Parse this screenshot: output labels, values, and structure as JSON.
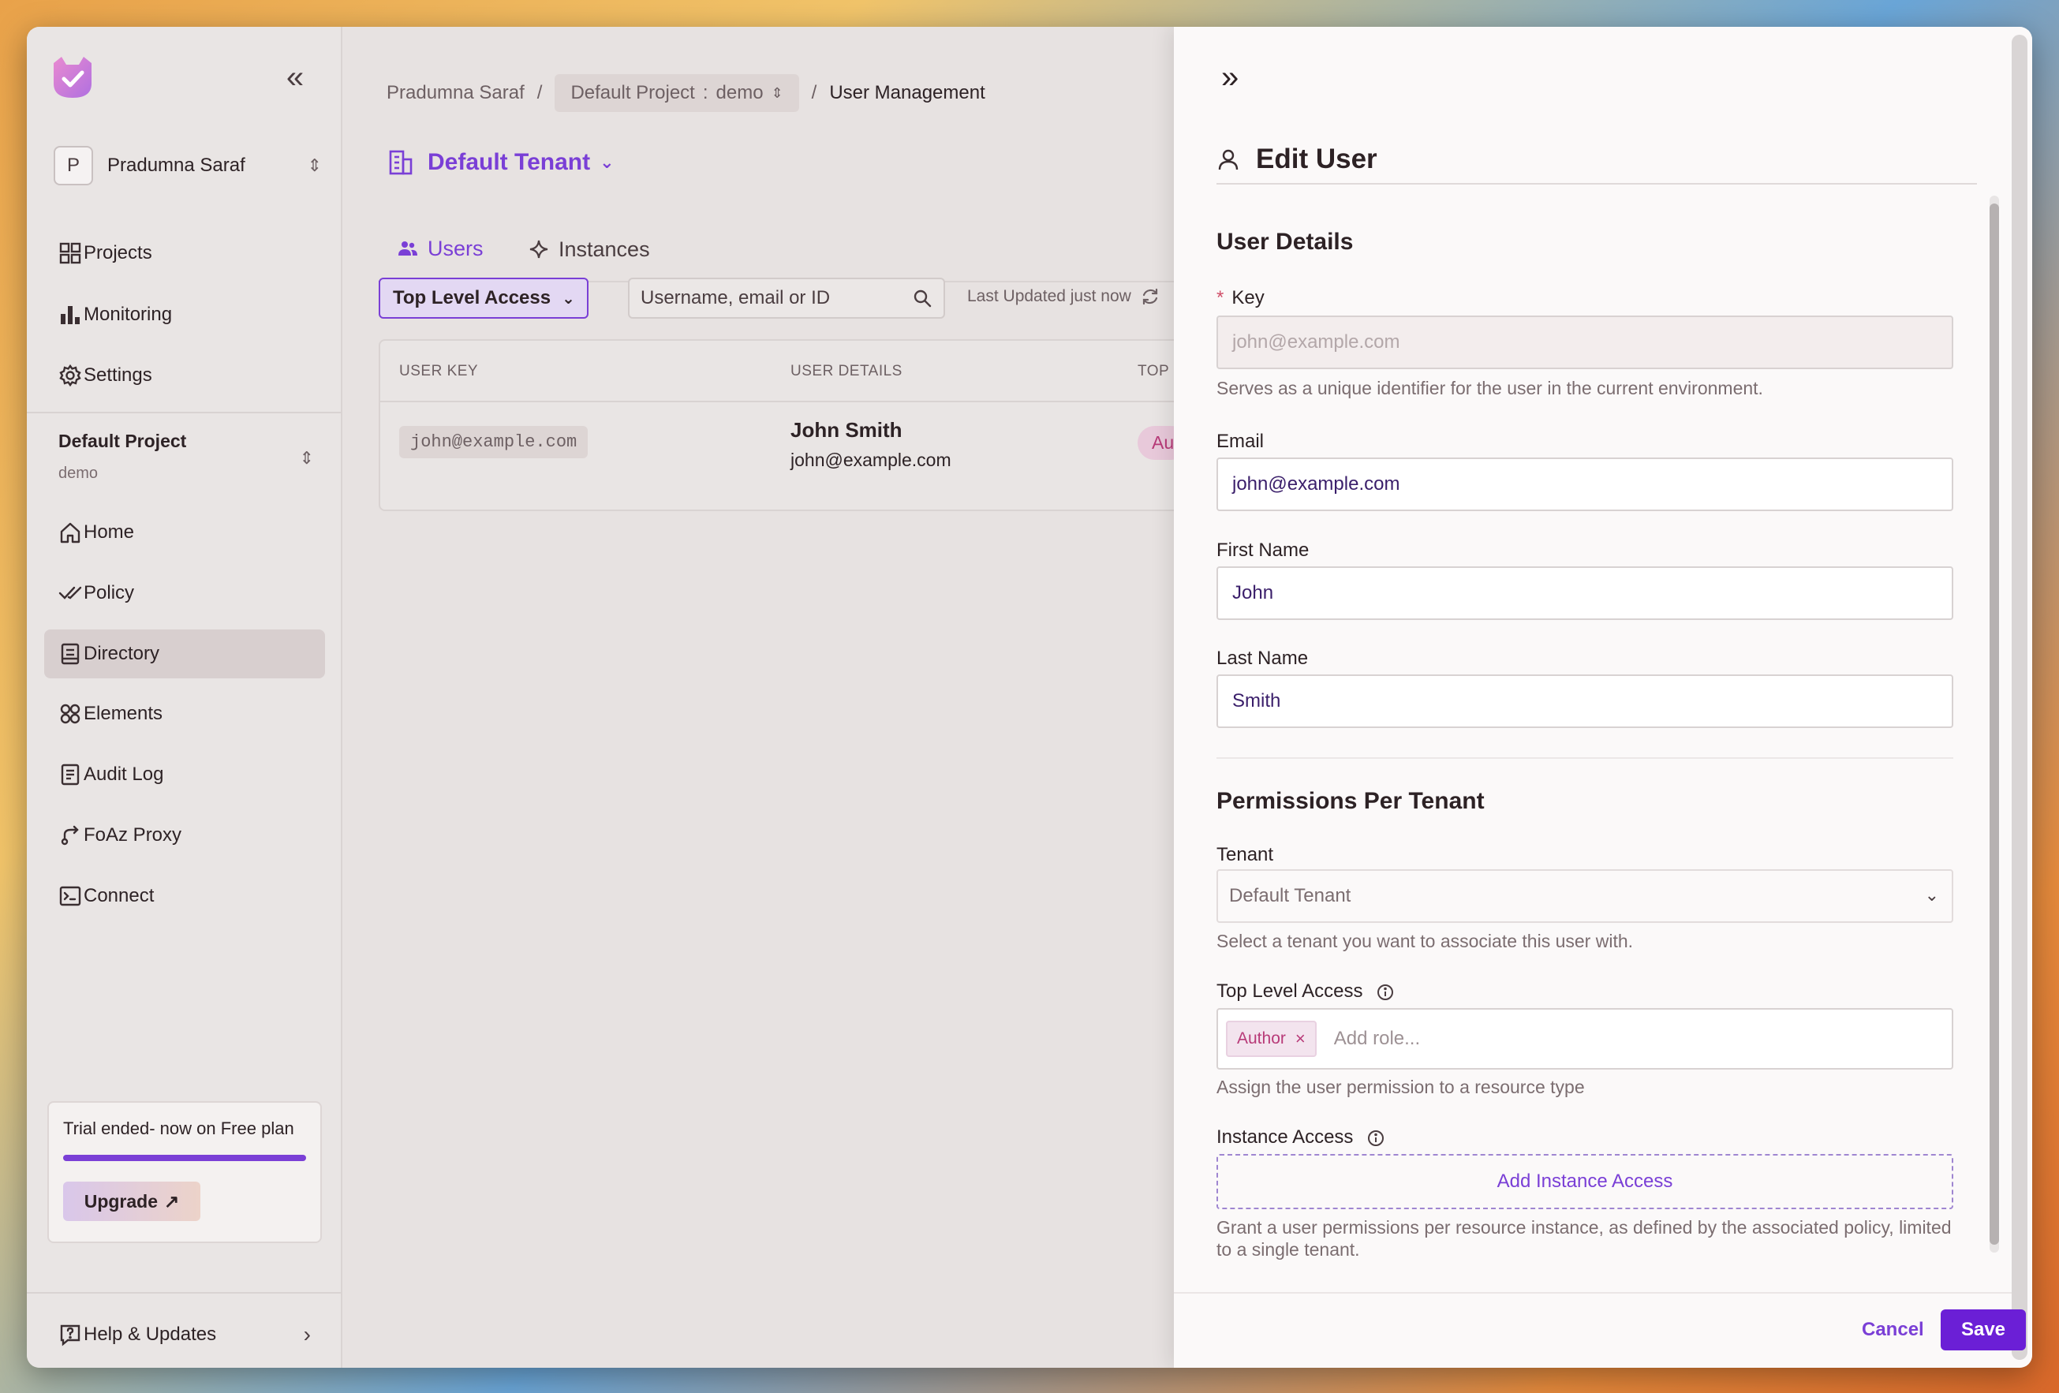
{
  "sidebar": {
    "collapse_icon": "chevrons-left-icon",
    "org": {
      "avatar_letter": "P",
      "name": "Pradumna Saraf"
    },
    "top_nav": [
      {
        "label": "Projects",
        "icon": "grid-icon"
      },
      {
        "label": "Monitoring",
        "icon": "bar-chart-icon"
      },
      {
        "label": "Settings",
        "icon": "gear-icon"
      }
    ],
    "project": {
      "name": "Default Project",
      "env": "demo"
    },
    "project_nav": [
      {
        "label": "Home",
        "icon": "home-icon"
      },
      {
        "label": "Policy",
        "icon": "double-check-icon"
      },
      {
        "label": "Directory",
        "icon": "directory-icon",
        "active": true
      },
      {
        "label": "Elements",
        "icon": "elements-icon"
      },
      {
        "label": "Audit Log",
        "icon": "document-icon"
      },
      {
        "label": "FoAz Proxy",
        "icon": "proxy-icon"
      },
      {
        "label": "Connect",
        "icon": "terminal-icon"
      }
    ],
    "trial": {
      "text": "Trial ended- now on Free plan",
      "progress_percent": 100,
      "upgrade_label": "Upgrade"
    },
    "help": {
      "label": "Help & Updates"
    }
  },
  "main": {
    "breadcrumb": {
      "org": "Pradumna Saraf",
      "project": "Default Project",
      "separator_colon": ":",
      "env": "demo",
      "current": "User Management",
      "slash": "/"
    },
    "tenant_title": "Default Tenant",
    "tabs": [
      {
        "label": "Users",
        "active": true
      },
      {
        "label": "Instances",
        "active": false
      }
    ],
    "filter_label": "Top Level Access",
    "search_placeholder": "Username, email or ID",
    "last_updated": "Last Updated just now",
    "table": {
      "headers": [
        "USER KEY",
        "USER DETAILS",
        "TOP L"
      ],
      "rows": [
        {
          "key": "john@example.com",
          "name": "John Smith",
          "email": "john@example.com",
          "role": "Au"
        }
      ]
    }
  },
  "drawer": {
    "title": "Edit User",
    "user_details_title": "User Details",
    "key": {
      "label": "Key",
      "required_mark": "*",
      "placeholder": "john@example.com",
      "help": "Serves as a unique identifier for the user in the current environment."
    },
    "email": {
      "label": "Email",
      "value": "john@example.com"
    },
    "first_name": {
      "label": "First Name",
      "value": "John"
    },
    "last_name": {
      "label": "Last Name",
      "value": "Smith"
    },
    "permissions_title": "Permissions Per Tenant",
    "tenant": {
      "label": "Tenant",
      "value": "Default Tenant",
      "help": "Select a tenant you want to associate this user with."
    },
    "top_level_access": {
      "label": "Top Level Access",
      "roles": [
        "Author"
      ],
      "placeholder": "Add role...",
      "help": "Assign the user permission to a resource type"
    },
    "instance_access": {
      "label": "Instance Access",
      "button": "Add Instance Access",
      "help": "Grant a user permissions per resource instance, as defined by the associated policy, limited to a single tenant."
    },
    "cancel_label": "Cancel",
    "save_label": "Save"
  },
  "colors": {
    "accent": "#7a3fd6",
    "save_button": "#6b1fd6",
    "role_pink": "#b83a78"
  }
}
